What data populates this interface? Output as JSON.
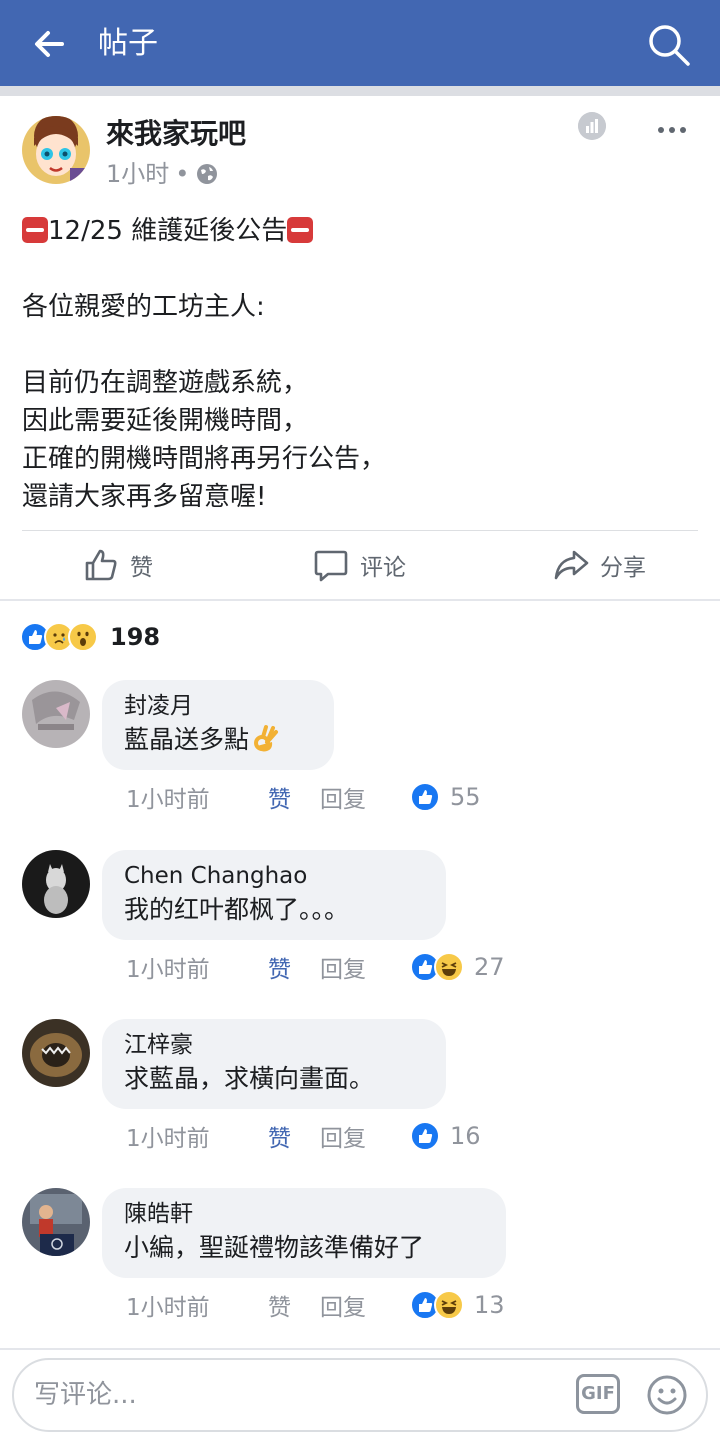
{
  "appbar": {
    "title": "帖子",
    "back_icon": "back-arrow-icon",
    "search_icon": "search-icon",
    "bg_color": "#4267b2"
  },
  "post": {
    "page_name": "來我家玩吧",
    "time": "1小时",
    "separator": "•",
    "audience_icon": "globe-icon",
    "title_line": "12/25 維護延後公告",
    "lines": [
      "各位親愛的工坊主人:",
      "目前仍在調整遊戲系統，",
      "因此需要延後開機時間，",
      "正確的開機時間將再另行公告，",
      "還請大家再多留意喔!"
    ]
  },
  "actions": {
    "like": "赞",
    "comment": "评论",
    "share": "分享"
  },
  "reactions": {
    "count": "198",
    "types": [
      "like",
      "sad",
      "wow"
    ]
  },
  "comments": [
    {
      "name": "封凌月",
      "text": "藍晶送多點",
      "emoji": "ok-hand",
      "time": "1小时前",
      "like": "赞",
      "reply": "回复",
      "liked": true,
      "reactions": [
        "like"
      ],
      "count": "55"
    },
    {
      "name": "Chen Changhao",
      "text": "我的红叶都枫了。。。",
      "time": "1小时前",
      "like": "赞",
      "reply": "回复",
      "liked": true,
      "reactions": [
        "like",
        "haha"
      ],
      "count": "27"
    },
    {
      "name": "江梓豪",
      "text": "求藍晶，求橫向畫面。",
      "time": "1小时前",
      "like": "赞",
      "reply": "回复",
      "liked": true,
      "reactions": [
        "like"
      ],
      "count": "16"
    },
    {
      "name": "陳皓軒",
      "text": "小編，聖誕禮物該準備好了",
      "time": "1小时前",
      "like": "赞",
      "reply": "回复",
      "liked": false,
      "reactions": [
        "like",
        "haha"
      ],
      "count": "13"
    }
  ],
  "composer": {
    "placeholder": "写评论...",
    "gif_label": "GIF",
    "emoji_icon": "smiley-icon"
  },
  "colors": {
    "accent": "#4267b2",
    "like_blue": "#1877f2",
    "muted": "#90949c"
  }
}
